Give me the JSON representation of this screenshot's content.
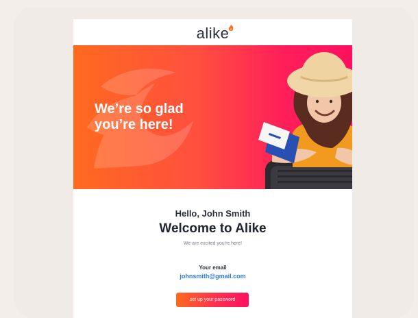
{
  "header": {
    "logo_text": "alike",
    "logo_icon": "flame-icon"
  },
  "hero": {
    "headline": "We’re so glad you’re here!",
    "image_icon": "traveler-photo",
    "bg_icon": "phoenix-watermark-icon"
  },
  "content": {
    "greeting": "Hello, John Smith",
    "title": "Welcome to Alike",
    "subtitle": "We are excited you're here!",
    "email_label": "Your email",
    "email_value": "johnsmith@gmail.com",
    "cta_label": "set up your password"
  },
  "colors": {
    "accent_start": "#ff6a1f",
    "accent_end": "#ff0f5f",
    "link": "#2c7be5",
    "text": "#1f2430"
  }
}
